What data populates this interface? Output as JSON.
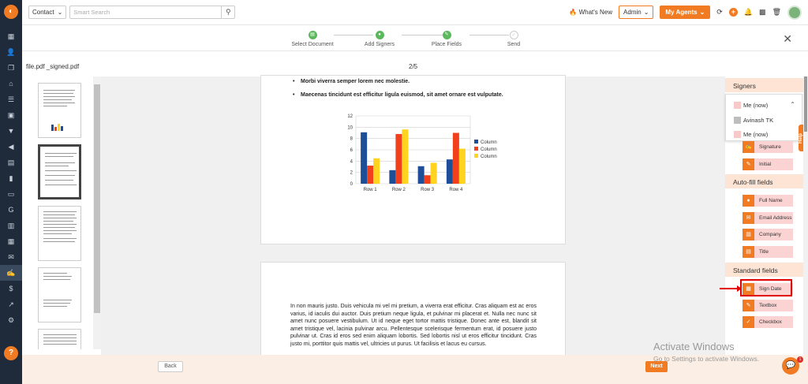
{
  "topbar": {
    "contact_label": "Contact",
    "search_placeholder": "Smart Search",
    "whats_new": "What's New",
    "admin_label": "Admin",
    "agents_label": "My Agents"
  },
  "steps": [
    {
      "label": "Select Document",
      "state": "done"
    },
    {
      "label": "Add Signers",
      "state": "done"
    },
    {
      "label": "Place Fields",
      "state": "done"
    },
    {
      "label": "Send",
      "state": "pending"
    }
  ],
  "file": {
    "name": "file.pdf _signed.pdf",
    "page": "2/5"
  },
  "page1": {
    "bullets": [
      "Morbi viverra semper lorem nec molestie.",
      "Maecenas tincidunt est efficitur ligula euismod, sit amet ornare est vulputate."
    ]
  },
  "chart_data": {
    "type": "bar",
    "categories": [
      "Row 1",
      "Row 2",
      "Row 3",
      "Row 4"
    ],
    "series": [
      {
        "name": "Column 1",
        "values": [
          9.1,
          2.4,
          3.1,
          4.3
        ],
        "color": "#1f4e99"
      },
      {
        "name": "Column 2",
        "values": [
          3.2,
          8.8,
          1.5,
          9.0
        ],
        "color": "#f0401c"
      },
      {
        "name": "Column 3",
        "values": [
          4.5,
          9.6,
          3.7,
          6.2
        ],
        "color": "#ffd320"
      }
    ],
    "ylim": [
      0,
      12
    ],
    "yticks": [
      "0",
      "2",
      "4",
      "6",
      "8",
      "10",
      "12"
    ],
    "legend": "right",
    "grid": true
  },
  "page2": {
    "text": "In non mauris justo. Duis vehicula mi vel mi pretium, a viverra erat efficitur. Cras aliquam est ac eros varius, id iaculis dui auctor. Duis pretium neque ligula, et pulvinar mi placerat et. Nulla nec nunc sit amet nunc posuere vestibulum. Ut id neque eget tortor mattis tristique. Donec ante est, blandit sit amet tristique vel, lacinia pulvinar arcu. Pellentesque scelerisque fermentum erat, id posuere justo pulvinar ut. Cras id eros sed enim aliquam lobortis. Sed lobortis nisl ut eros efficitur tincidunt. Cras justo mi, porttitor quis mattis vel, ultricies ut purus. Ut facilisis et lacus eu cursus."
  },
  "panel": {
    "signers_heading": "Signers",
    "signers": [
      {
        "label": "Me (now)",
        "color": "#f8c9c9"
      },
      {
        "label": "Avinash TK",
        "color": "#bdbdbd"
      },
      {
        "label": "Me (now)",
        "color": "#f8c9c9"
      }
    ],
    "signer_fields": [
      "Signature",
      "Initial"
    ],
    "autofill_heading": "Auto-fill fields",
    "autofill_fields": [
      "Full Name",
      "Email Address",
      "Company",
      "Title"
    ],
    "standard_heading": "Standard fields",
    "standard_fields": [
      "Sign Date",
      "Textbox",
      "Checkbox"
    ],
    "help_tab": "Help"
  },
  "bottom": {
    "back_label": "Back",
    "next_label": "Next"
  },
  "watermark": {
    "line1": "Activate Windows",
    "line2": "Go to Settings to activate Windows."
  },
  "chat_badge": "1"
}
